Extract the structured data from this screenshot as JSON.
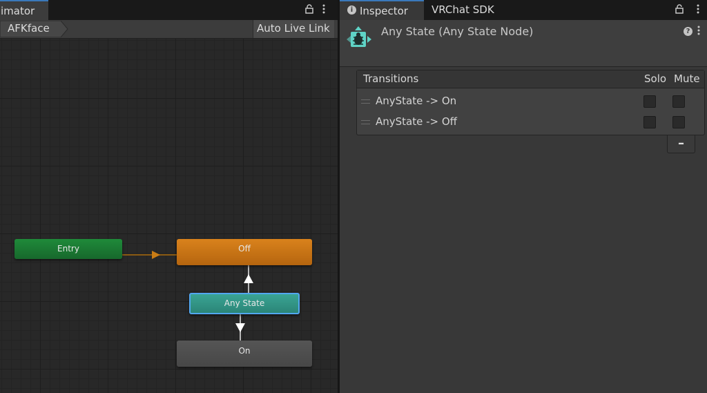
{
  "animator": {
    "tab_label": "imator",
    "breadcrumb": "AFKface",
    "auto_live_link": "Auto Live Link",
    "nodes": {
      "entry": "Entry",
      "off": "Off",
      "any_state": "Any State",
      "on": "On"
    }
  },
  "inspector": {
    "tabs": {
      "inspector": "Inspector",
      "vrchat_sdk": "VRChat SDK"
    },
    "title": "Any State (Any State Node)",
    "transitions": {
      "header": "Transitions",
      "solo_label": "Solo",
      "mute_label": "Mute",
      "items": [
        {
          "label": "AnyState -> On",
          "solo": false,
          "mute": false
        },
        {
          "label": "AnyState -> Off",
          "solo": false,
          "mute": false
        }
      ],
      "remove_label": "–"
    }
  },
  "colors": {
    "entry": "#1f8a3a",
    "off": "#d9821c",
    "any_state": "#3aa494",
    "on": "#555555",
    "selection": "#52a8f0",
    "tab_accent": "#3a79bb"
  },
  "icons": [
    "lock-icon",
    "more-vertical-icon",
    "info-icon",
    "any-state-node-icon",
    "help-icon"
  ]
}
